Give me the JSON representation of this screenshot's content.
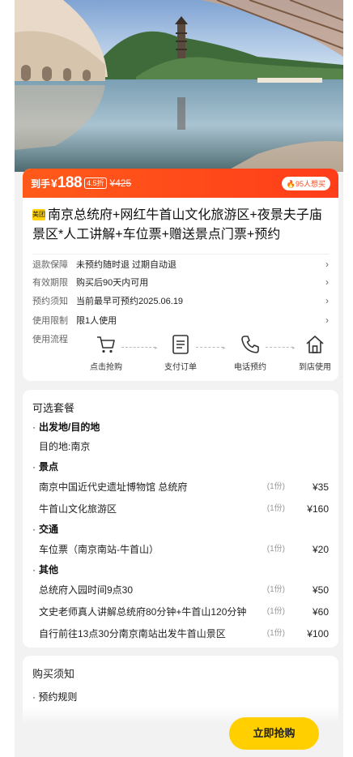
{
  "price_bar": {
    "prefix": "到手",
    "currency": "¥",
    "price": "188",
    "discount": "4.5折",
    "original": "¥425",
    "hot": "🔥95人想买"
  },
  "product": {
    "tag": "美团",
    "title": "南京总统府+网红牛首山文化旅游区+夜景夫子庙景区*人工讲解+车位票+赠送景点门票+预约"
  },
  "info": [
    {
      "key": "退款保障",
      "value": "未预约随时退 过期自动退"
    },
    {
      "key": "有效期限",
      "value": "购买后90天内可用"
    },
    {
      "key": "预约须知",
      "value": "当前最早可预约2025.06.19"
    },
    {
      "key": "使用限制",
      "value": "限1人使用"
    }
  ],
  "flow": {
    "label": "使用流程",
    "steps": [
      {
        "label": "点击抢购",
        "icon": "cart-icon"
      },
      {
        "label": "支付订单",
        "icon": "order-icon"
      },
      {
        "label": "电话预约",
        "icon": "phone-icon"
      },
      {
        "label": "到店使用",
        "icon": "home-icon"
      }
    ]
  },
  "package": {
    "title": "可选套餐",
    "groups": [
      {
        "name": "出发地/目的地",
        "items": [
          {
            "name": "目的地:南京"
          }
        ]
      },
      {
        "name": "景点",
        "items": [
          {
            "name": "南京中国近代史遗址博物馆 总统府",
            "qty": "(1份)",
            "price": "¥35"
          },
          {
            "name": "牛首山文化旅游区",
            "qty": "(1份)",
            "price": "¥160"
          }
        ]
      },
      {
        "name": "交通",
        "items": [
          {
            "name": "车位票（南京南站-牛首山）",
            "qty": "(1份)",
            "price": "¥20"
          }
        ]
      },
      {
        "name": "其他",
        "items": [
          {
            "name": "总统府入园时间9点30",
            "qty": "(1份)",
            "price": "¥50"
          },
          {
            "name": "文史老师真人讲解总统府80分钟+牛首山120分钟",
            "qty": "(1份)",
            "price": "¥60"
          },
          {
            "name": "自行前往13点30分南京南站出发牛首山景区",
            "qty": "(1份)",
            "price": "¥100"
          }
        ]
      }
    ]
  },
  "notice": {
    "title": "购买须知",
    "sub": "预约规则"
  },
  "buy_button": "立即抢购",
  "colors": {
    "accent": "#ff4a1a",
    "button": "#ffcf00"
  }
}
